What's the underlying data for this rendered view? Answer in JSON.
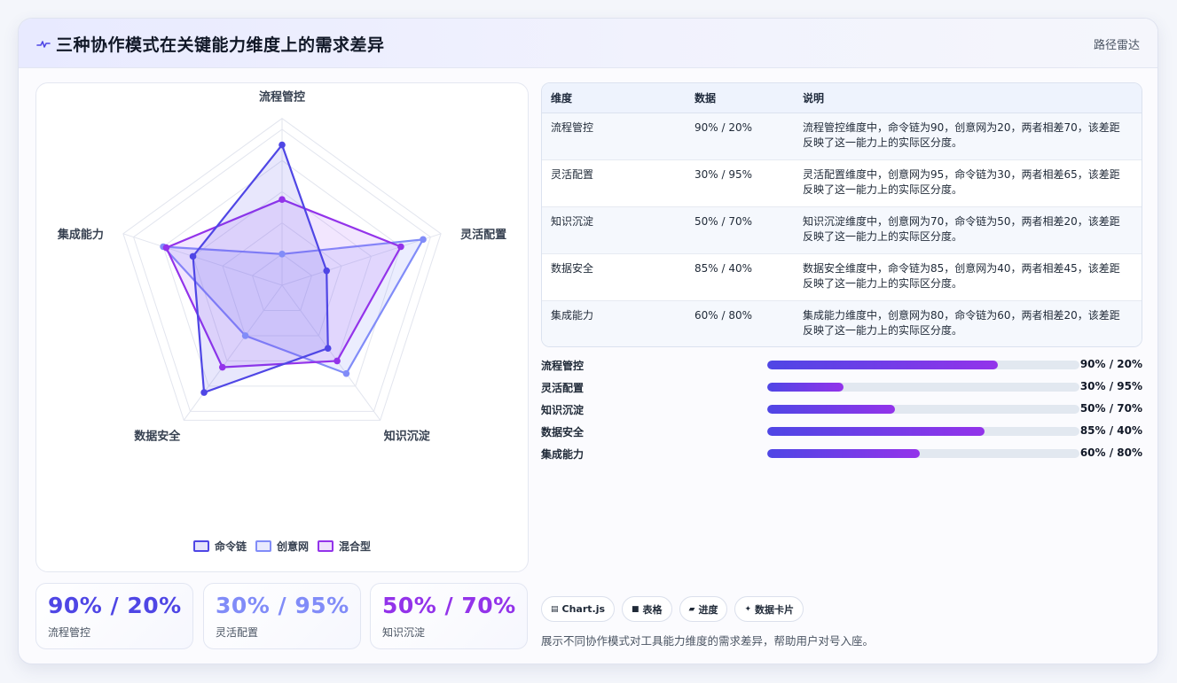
{
  "header": {
    "title": "三种协作模式在关键能力维度上的需求差异",
    "tag": "路径雷达"
  },
  "colors": {
    "command": "#4f46e5",
    "creative": "#818cf8",
    "hybrid": "#9333ea"
  },
  "chart_data": {
    "type": "radar",
    "axes": [
      "流程管控",
      "灵活配置",
      "知识沉淀",
      "数据安全",
      "集成能力"
    ],
    "range": [
      0,
      100
    ],
    "series": [
      {
        "name": "命令链",
        "values": [
          90,
          30,
          50,
          85,
          60
        ]
      },
      {
        "name": "创意网",
        "values": [
          20,
          95,
          70,
          40,
          80
        ]
      },
      {
        "name": "混合型",
        "values": [
          55,
          80,
          60,
          65,
          78
        ]
      }
    ],
    "legend_position": "bottom"
  },
  "stats": [
    {
      "value": "90% / 20%",
      "label": "流程管控",
      "color": "#4f46e5"
    },
    {
      "value": "30% / 95%",
      "label": "灵活配置",
      "color": "#818cf8"
    },
    {
      "value": "50% / 70%",
      "label": "知识沉淀",
      "color": "#9333ea"
    }
  ],
  "table": {
    "headers": [
      "维度",
      "数据",
      "说明"
    ],
    "rows": [
      {
        "dim": "流程管控",
        "data": "90% / 20%",
        "desc": "流程管控维度中，命令链为90，创意网为20，两者相差70，该差距反映了这一能力上的实际区分度。"
      },
      {
        "dim": "灵活配置",
        "data": "30% / 95%",
        "desc": "灵活配置维度中，创意网为95，命令链为30，两者相差65，该差距反映了这一能力上的实际区分度。"
      },
      {
        "dim": "知识沉淀",
        "data": "50% / 70%",
        "desc": "知识沉淀维度中，创意网为70，命令链为50，两者相差20，该差距反映了这一能力上的实际区分度。"
      },
      {
        "dim": "数据安全",
        "data": "85% / 40%",
        "desc": "数据安全维度中，命令链为85，创意网为40，两者相差45，该差距反映了这一能力上的实际区分度。"
      },
      {
        "dim": "集成能力",
        "data": "60% / 80%",
        "desc": "集成能力维度中，创意网为80，命令链为60，两者相差20，该差距反映了这一能力上的实际区分度。"
      }
    ]
  },
  "progress": [
    {
      "label": "流程管控",
      "value": "90% / 20%",
      "fill": 0.74
    },
    {
      "label": "灵活配置",
      "value": "30% / 95%",
      "fill": 0.245
    },
    {
      "label": "知识沉淀",
      "value": "50% / 70%",
      "fill": 0.41
    },
    {
      "label": "数据安全",
      "value": "85% / 40%",
      "fill": 0.695
    },
    {
      "label": "集成能力",
      "value": "60% / 80%",
      "fill": 0.49
    }
  ],
  "chips": [
    {
      "icon": "chart-icon",
      "label": "Chart.js"
    },
    {
      "icon": "table-icon",
      "label": "表格"
    },
    {
      "icon": "progress-icon",
      "label": "进度"
    },
    {
      "icon": "data-card-icon",
      "label": "数据卡片"
    }
  ],
  "note": "展示不同协作模式对工具能力维度的需求差异，帮助用户对号入座。"
}
